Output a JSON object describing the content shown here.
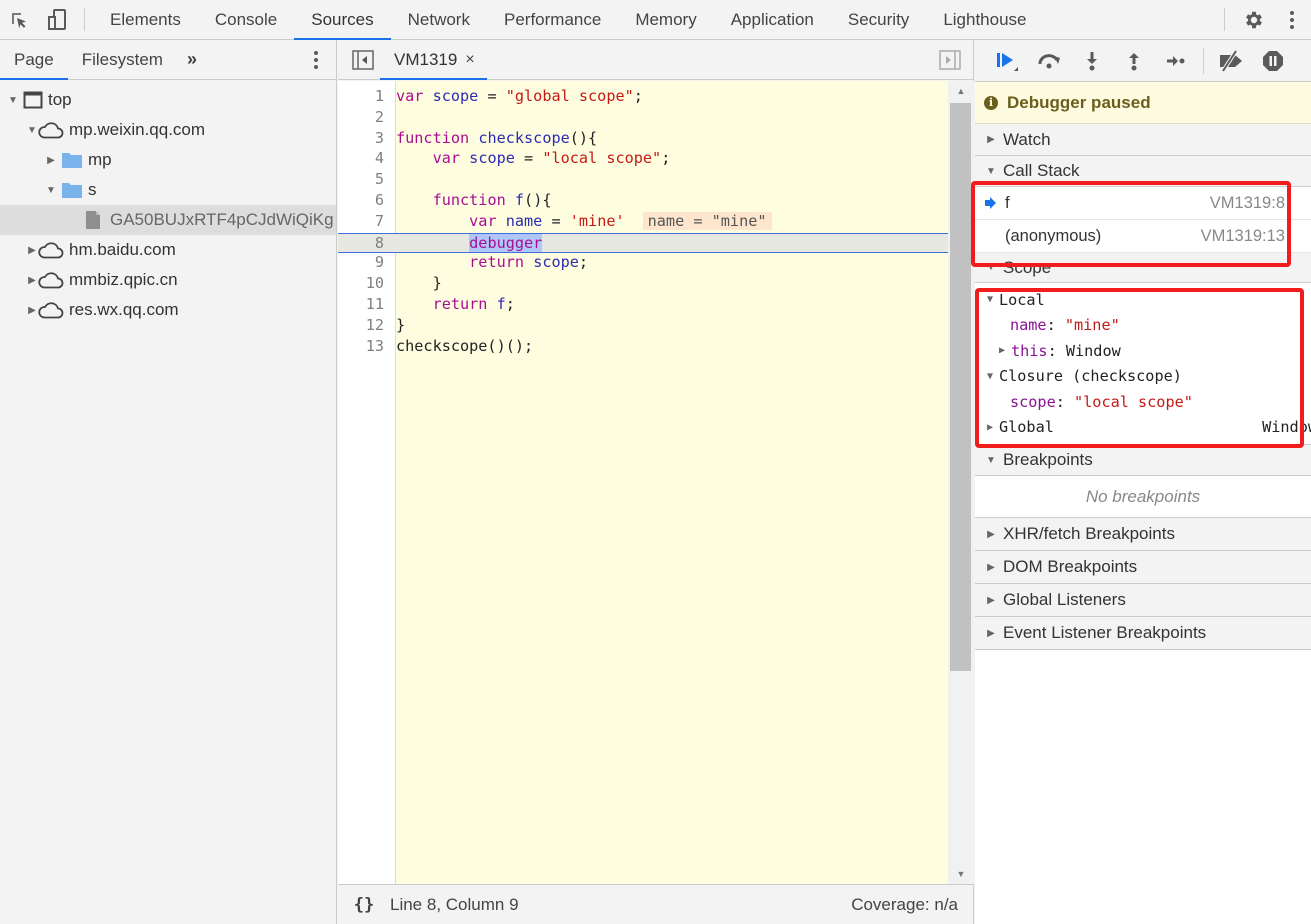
{
  "topbar": {
    "tabs": [
      {
        "label": "Elements",
        "active": false
      },
      {
        "label": "Console",
        "active": false
      },
      {
        "label": "Sources",
        "active": true
      },
      {
        "label": "Network",
        "active": false
      },
      {
        "label": "Performance",
        "active": false
      },
      {
        "label": "Memory",
        "active": false
      },
      {
        "label": "Application",
        "active": false
      },
      {
        "label": "Security",
        "active": false
      },
      {
        "label": "Lighthouse",
        "active": false
      }
    ],
    "icons": [
      "inspect-element-icon",
      "device-toolbar-icon",
      "settings-gear-icon",
      "more-options-icon"
    ]
  },
  "navigator": {
    "tabs": [
      {
        "label": "Page",
        "active": true
      },
      {
        "label": "Filesystem",
        "active": false
      }
    ],
    "more_label": "»",
    "tree": [
      {
        "label": "top",
        "icon": "frame-icon",
        "expanded": true,
        "depth": 0
      },
      {
        "label": "mp.weixin.qq.com",
        "icon": "cloud-icon",
        "expanded": true,
        "depth": 1
      },
      {
        "label": "mp",
        "icon": "folder-icon",
        "expanded": false,
        "depth": 2
      },
      {
        "label": "s",
        "icon": "folder-icon",
        "expanded": true,
        "depth": 2
      },
      {
        "label": "GA50BUJxRTF4pCJdWiQiKg",
        "icon": "file-icon",
        "selected": true,
        "depth": 3
      },
      {
        "label": "hm.baidu.com",
        "icon": "cloud-icon",
        "expanded": false,
        "depth": 1
      },
      {
        "label": "mmbiz.qpic.cn",
        "icon": "cloud-icon",
        "expanded": false,
        "depth": 1
      },
      {
        "label": "res.wx.qq.com",
        "icon": "cloud-icon",
        "expanded": false,
        "depth": 1
      }
    ]
  },
  "editor": {
    "file_tab": "VM1319",
    "close_glyph": "×",
    "current_line": 8,
    "lines": [
      {
        "n": "1",
        "tokens": [
          [
            "kw",
            "var"
          ],
          [
            "pl",
            " "
          ],
          [
            "vr",
            "scope"
          ],
          [
            "pl",
            " = "
          ],
          [
            "str",
            "\"global scope\""
          ],
          [
            "pl",
            ";"
          ]
        ]
      },
      {
        "n": "2",
        "tokens": []
      },
      {
        "n": "3",
        "tokens": [
          [
            "kw",
            "function"
          ],
          [
            "pl",
            " "
          ],
          [
            "vr",
            "checkscope"
          ],
          [
            "pl",
            "(){"
          ]
        ]
      },
      {
        "n": "4",
        "tokens": [
          [
            "pl",
            "    "
          ],
          [
            "kw",
            "var"
          ],
          [
            "pl",
            " "
          ],
          [
            "vr",
            "scope"
          ],
          [
            "pl",
            " = "
          ],
          [
            "str",
            "\"local scope\""
          ],
          [
            "pl",
            ";"
          ]
        ]
      },
      {
        "n": "5",
        "tokens": []
      },
      {
        "n": "6",
        "tokens": [
          [
            "pl",
            "    "
          ],
          [
            "kw",
            "function"
          ],
          [
            "pl",
            " "
          ],
          [
            "vr",
            "f"
          ],
          [
            "pl",
            "(){"
          ]
        ]
      },
      {
        "n": "7",
        "tokens": [
          [
            "pl",
            "        "
          ],
          [
            "kw",
            "var"
          ],
          [
            "pl",
            " "
          ],
          [
            "vr",
            "name"
          ],
          [
            "pl",
            " = "
          ],
          [
            "str",
            "'mine'"
          ]
        ],
        "inline_value": "name = \"mine\""
      },
      {
        "n": "8",
        "tokens": [
          [
            "pl",
            "        "
          ],
          [
            "dbg",
            "debugger"
          ]
        ]
      },
      {
        "n": "9",
        "tokens": [
          [
            "pl",
            "        "
          ],
          [
            "kw",
            "return"
          ],
          [
            "pl",
            " "
          ],
          [
            "vr",
            "scope"
          ],
          [
            "pl",
            ";"
          ]
        ]
      },
      {
        "n": "10",
        "tokens": [
          [
            "pl",
            "    }"
          ]
        ]
      },
      {
        "n": "11",
        "tokens": [
          [
            "pl",
            "    "
          ],
          [
            "kw",
            "return"
          ],
          [
            "pl",
            " "
          ],
          [
            "vr",
            "f"
          ],
          [
            "pl",
            ";"
          ]
        ]
      },
      {
        "n": "12",
        "tokens": [
          [
            "pl",
            "}"
          ]
        ]
      },
      {
        "n": "13",
        "tokens": [
          [
            "pl",
            "checkscope()();"
          ]
        ]
      }
    ],
    "status": {
      "pretty_print": "{}",
      "position": "Line 8, Column 9",
      "coverage": "Coverage: n/a"
    }
  },
  "debugger": {
    "controls": [
      "resume-icon",
      "step-over-icon",
      "step-into-icon",
      "step-out-icon",
      "step-icon",
      "deactivate-breakpoints-icon",
      "pause-on-exceptions-icon"
    ],
    "paused_label": "Debugger paused",
    "watch_label": "Watch",
    "call_stack_label": "Call Stack",
    "call_stack": [
      {
        "fn": "f",
        "location": "VM1319:8",
        "current": true
      },
      {
        "fn": "(anonymous)",
        "location": "VM1319:13",
        "current": false
      }
    ],
    "scope_label": "Scope",
    "scope": {
      "local_label": "Local",
      "local_vars": [
        {
          "name": "name",
          "value": "\"mine\"",
          "type": "string"
        },
        {
          "name": "this",
          "value": "Window",
          "type": "object"
        }
      ],
      "closure_label": "Closure (checkscope)",
      "closure_vars": [
        {
          "name": "scope",
          "value": "\"local scope\"",
          "type": "string"
        }
      ],
      "global_label": "Global",
      "global_value": "Window"
    },
    "breakpoints_label": "Breakpoints",
    "no_breakpoints": "No breakpoints",
    "sections": [
      "XHR/fetch Breakpoints",
      "DOM Breakpoints",
      "Global Listeners",
      "Event Listener Breakpoints"
    ]
  },
  "colors": {
    "accent": "#1a73e8",
    "highlight_box": "#f21c1c",
    "paused_bg": "#fffbe0",
    "editor_bg": "#fefde0"
  }
}
